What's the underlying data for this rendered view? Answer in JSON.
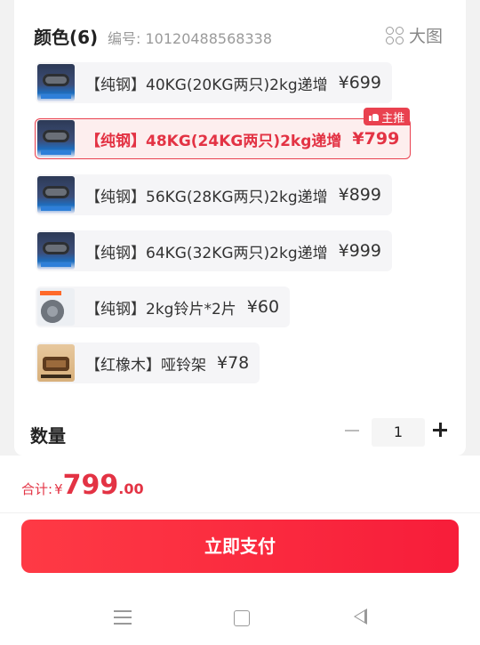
{
  "header": {
    "title": "颜色(6)",
    "sku_label": "编号: 10120488568338",
    "big_image_label": "大图"
  },
  "variants": [
    {
      "label": "【纯钢】40KG(20KG两只)2kg递增",
      "price": "¥699",
      "thumb": "dumbbell-product-image"
    },
    {
      "label": "【纯钢】48KG(24KG两只)2kg递增",
      "price": "¥799",
      "thumb": "dumbbell-product-image",
      "selected": true,
      "badge": "主推"
    },
    {
      "label": "【纯钢】56KG(28KG两只)2kg递增",
      "price": "¥899",
      "thumb": "dumbbell-product-image"
    },
    {
      "label": "【纯钢】64KG(32KG两只)2kg递增",
      "price": "¥999",
      "thumb": "dumbbell-product-image"
    },
    {
      "label": "【纯钢】2kg铃片*2片",
      "price": "¥60",
      "thumb": "weight-plate-image"
    },
    {
      "label": "【红橡木】哑铃架",
      "price": "¥78",
      "thumb": "dumbbell-rack-image"
    }
  ],
  "quantity": {
    "label": "数量",
    "value": "1"
  },
  "total": {
    "label": "合计:",
    "currency": "¥",
    "integer": "799",
    "decimal": ".00"
  },
  "pay_button": "立即支付",
  "colors": {
    "accent": "#e9414f",
    "pay_button": "#f71d3a",
    "price_text": "#e33344"
  },
  "icons": [
    "grid-icon",
    "thumbs-up-icon",
    "minus-icon",
    "plus-icon",
    "menu-nav-icon",
    "home-nav-icon",
    "back-nav-icon"
  ]
}
